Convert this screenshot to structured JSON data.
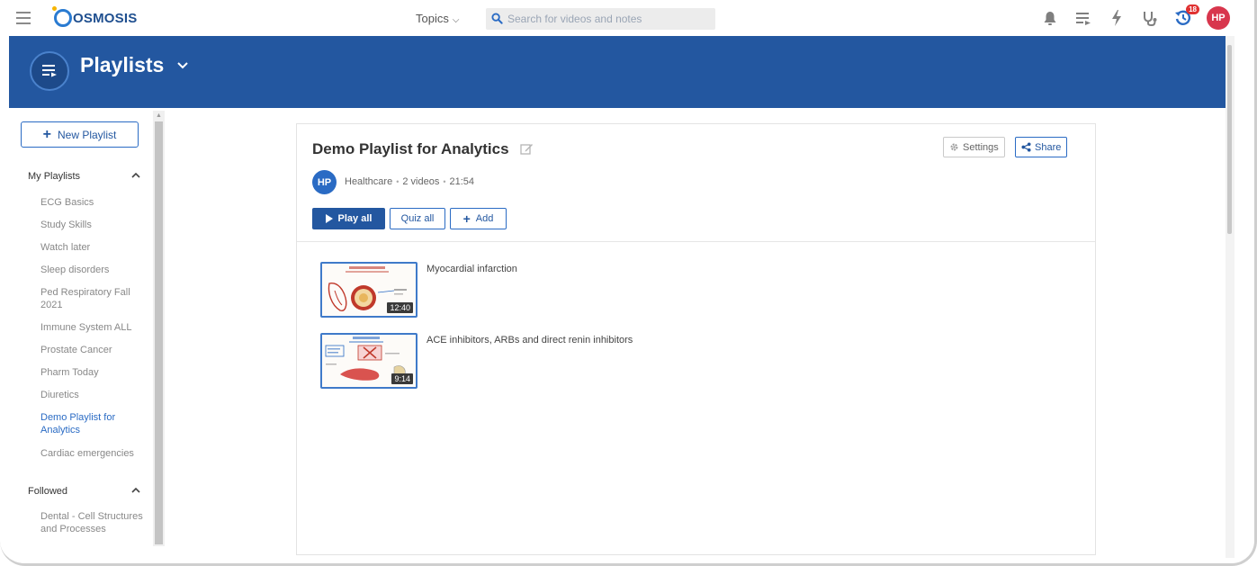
{
  "topbar": {
    "logo_text": "OSMOSIS",
    "topics_label": "Topics",
    "search_placeholder": "Search for videos and notes",
    "history_badge": "18",
    "avatar_initials": "HP"
  },
  "banner": {
    "title": "Playlists"
  },
  "sidebar": {
    "new_playlist_label": "New Playlist",
    "my_playlists": {
      "heading": "My Playlists",
      "items": [
        {
          "label": "ECG Basics"
        },
        {
          "label": "Study Skills"
        },
        {
          "label": "Watch later"
        },
        {
          "label": "Sleep disorders"
        },
        {
          "label": "Ped Respiratory Fall 2021"
        },
        {
          "label": "Immune System ALL"
        },
        {
          "label": "Prostate Cancer"
        },
        {
          "label": "Pharm Today"
        },
        {
          "label": "Diuretics"
        },
        {
          "label": "Demo Playlist for Analytics",
          "active": true
        },
        {
          "label": "Cardiac emergencies"
        }
      ]
    },
    "followed": {
      "heading": "Followed",
      "items": [
        {
          "label": "Dental - Cell Structures and Processes"
        }
      ]
    }
  },
  "playlist": {
    "title": "Demo Playlist for Analytics",
    "settings_label": "Settings",
    "share_label": "Share",
    "owner_initials": "HP",
    "owner_name": "Healthcare",
    "video_count": "2 videos",
    "total_duration": "21:54",
    "play_all_label": "Play all",
    "quiz_all_label": "Quiz all",
    "add_label": "Add",
    "videos": [
      {
        "title": "Myocardial infarction",
        "duration": "12:40"
      },
      {
        "title": "ACE inhibitors, ARBs and direct renin inhibitors",
        "duration": "9:14"
      }
    ]
  },
  "colors": {
    "brand_blue": "#2357a0",
    "accent_blue": "#2a6bc4",
    "avatar_red": "#d8364d"
  }
}
